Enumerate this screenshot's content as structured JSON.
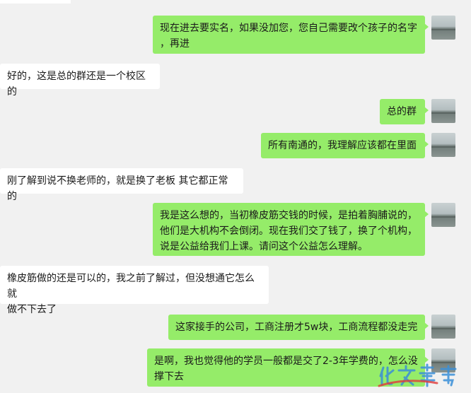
{
  "messages": [
    {
      "side": "right",
      "lines": [
        "现在进去要实名，如果没加您，您自己需要改个孩子的名字",
        "，再进"
      ]
    },
    {
      "side": "left",
      "lines": [
        "好的，这是总的群还是一个校区的"
      ]
    },
    {
      "side": "right",
      "lines": [
        "总的群"
      ]
    },
    {
      "side": "right",
      "lines": [
        "所有南通的，我理解应该都在里面"
      ]
    },
    {
      "side": "left",
      "lines": [
        "刚了解到说不换老师的，就是换了老板 其它都正常的"
      ]
    },
    {
      "side": "right",
      "lines": [
        "我是这么想的，当初橡皮筋交钱的时候，是拍着胸脯说的，",
        "他们是大机构不会倒闭。现在我们交了钱了，换了个机构，",
        "说是公益给我们上课。请问这个公益怎么理解。"
      ]
    },
    {
      "side": "left",
      "lines": [
        "橡皮筋做的还是可以的，我之前了解过，但没想通它怎么就",
        "做不下去了"
      ]
    },
    {
      "side": "right",
      "lines": [
        "这家接手的公司，工商注册才5w块，工商流程都没走完"
      ]
    },
    {
      "side": "right",
      "lines": [
        "是啊，我也觉得他的学员一般都是交了2-3年学费的，怎么没",
        "撑下去"
      ]
    }
  ]
}
